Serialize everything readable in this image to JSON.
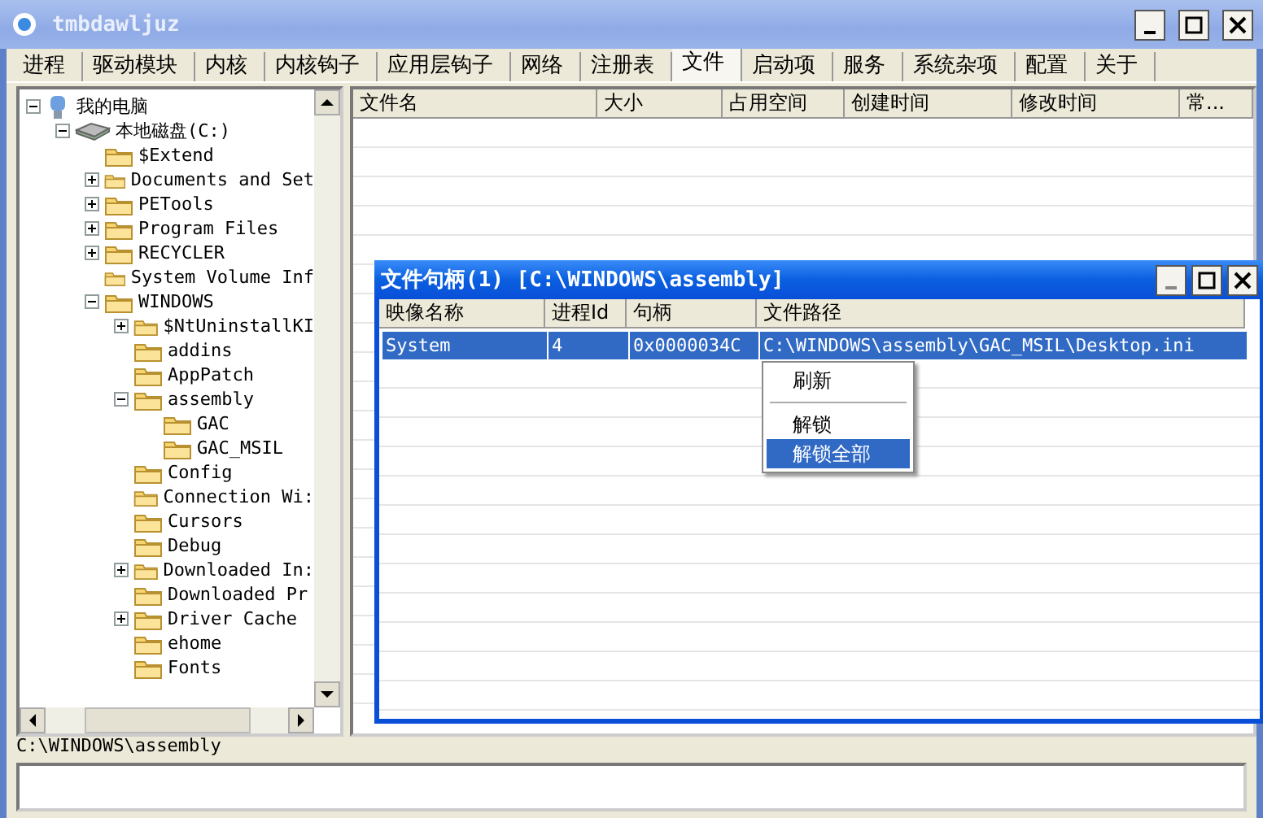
{
  "window": {
    "title": "tmbdawljuz"
  },
  "tabs": [
    {
      "label": "进程",
      "selected": false
    },
    {
      "label": "驱动模块",
      "selected": false
    },
    {
      "label": "内核",
      "selected": false
    },
    {
      "label": "内核钩子",
      "selected": false
    },
    {
      "label": "应用层钩子",
      "selected": false
    },
    {
      "label": "网络",
      "selected": false
    },
    {
      "label": "注册表",
      "selected": false
    },
    {
      "label": "文件",
      "selected": true
    },
    {
      "label": "启动项",
      "selected": false
    },
    {
      "label": "服务",
      "selected": false
    },
    {
      "label": "系统杂项",
      "selected": false
    },
    {
      "label": "配置",
      "selected": false
    },
    {
      "label": "关于",
      "selected": false
    }
  ],
  "tree": [
    {
      "label": "我的电脑",
      "kind": "computer",
      "expanded": true,
      "children": [
        {
          "label": "本地磁盘(C:)",
          "kind": "drive",
          "expanded": true,
          "children": [
            {
              "label": "$Extend",
              "kind": "folder"
            },
            {
              "label": "Documents and Set",
              "kind": "folder",
              "expanded": false
            },
            {
              "label": "PETools",
              "kind": "folder",
              "expanded": false
            },
            {
              "label": "Program Files",
              "kind": "folder",
              "expanded": false
            },
            {
              "label": "RECYCLER",
              "kind": "folder",
              "expanded": false
            },
            {
              "label": "System Volume Inf",
              "kind": "folder"
            },
            {
              "label": "WINDOWS",
              "kind": "folder",
              "expanded": true,
              "children": [
                {
                  "label": "$NtUninstallKI",
                  "kind": "folder",
                  "expanded": false
                },
                {
                  "label": "addins",
                  "kind": "folder"
                },
                {
                  "label": "AppPatch",
                  "kind": "folder"
                },
                {
                  "label": "assembly",
                  "kind": "folder",
                  "expanded": true,
                  "children": [
                    {
                      "label": "GAC",
                      "kind": "folder"
                    },
                    {
                      "label": "GAC_MSIL",
                      "kind": "folder"
                    }
                  ]
                },
                {
                  "label": "Config",
                  "kind": "folder"
                },
                {
                  "label": "Connection Wi:",
                  "kind": "folder"
                },
                {
                  "label": "Cursors",
                  "kind": "folder"
                },
                {
                  "label": "Debug",
                  "kind": "folder"
                },
                {
                  "label": "Downloaded In:",
                  "kind": "folder",
                  "expanded": false
                },
                {
                  "label": "Downloaded Pr",
                  "kind": "folder"
                },
                {
                  "label": "Driver Cache",
                  "kind": "folder",
                  "expanded": false
                },
                {
                  "label": "ehome",
                  "kind": "folder"
                },
                {
                  "label": "Fonts",
                  "kind": "folder"
                }
              ]
            }
          ]
        }
      ]
    }
  ],
  "file_list": {
    "columns": [
      "文件名",
      "大小",
      "占用空间",
      "创建时间",
      "修改时间",
      "常..."
    ]
  },
  "handle_window": {
    "title": "文件句柄(1) [C:\\WINDOWS\\assembly]",
    "columns": [
      "映像名称",
      "进程Id",
      "句柄",
      "文件路径"
    ],
    "rows": [
      {
        "selected": true,
        "cells": [
          "System",
          "4",
          "0x0000034C",
          "C:\\WINDOWS\\assembly\\GAC_MSIL\\Desktop.ini"
        ]
      }
    ]
  },
  "context_menu": [
    {
      "label": "刷新",
      "selected": false
    },
    {
      "kind": "separator"
    },
    {
      "label": "解锁",
      "selected": false
    },
    {
      "label": "解锁全部",
      "selected": true
    }
  ],
  "status_bar": {
    "path": "C:\\WINDOWS\\assembly"
  }
}
